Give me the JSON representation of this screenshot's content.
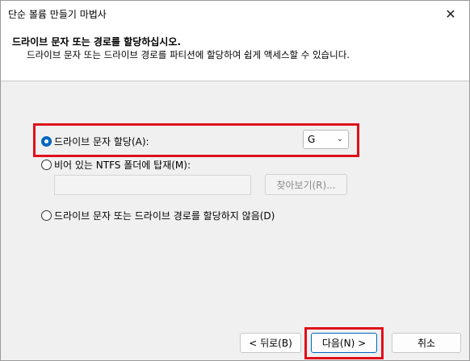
{
  "window": {
    "title": "단순 볼륨 만들기 마법사",
    "close_glyph": "✕"
  },
  "header": {
    "title": "드라이브 문자 또는 경로를 할당하십시오.",
    "subtitle": "드라이브 문자 또는 드라이브 경로를 파티션에 할당하여 쉽게 액세스할 수 있습니다."
  },
  "options": {
    "assign_letter": {
      "label": "드라이브 문자 할당(A):",
      "selected": true
    },
    "drive_letter": {
      "value": "G"
    },
    "mount_ntfs": {
      "label": "비어 있는 NTFS 폴더에 탑재(M):",
      "path_value": "",
      "browse_label": "찾아보기(R)..."
    },
    "no_assign": {
      "label": "드라이브 문자 또는 드라이브 경로를 할당하지 않음(D)"
    }
  },
  "footer": {
    "back_label": "< 뒤로(B)",
    "next_label": "다음(N) >",
    "cancel_label": "취소"
  },
  "colors": {
    "highlight": "#e0101a",
    "accent": "#0067c0"
  }
}
